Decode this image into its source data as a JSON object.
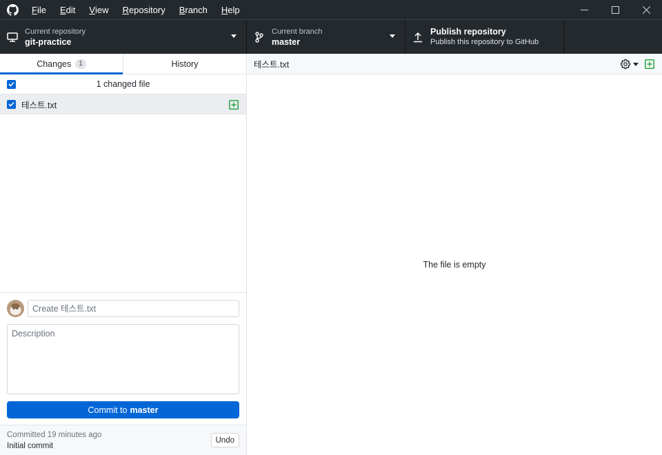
{
  "menu": {
    "items": [
      {
        "underline": "F",
        "rest": "ile"
      },
      {
        "underline": "E",
        "rest": "dit"
      },
      {
        "underline": "V",
        "rest": "iew"
      },
      {
        "underline": "R",
        "rest": "epository"
      },
      {
        "underline": "B",
        "rest": "ranch"
      },
      {
        "underline": "H",
        "rest": "elp"
      }
    ]
  },
  "window_controls": {
    "minimize": "—",
    "maximize": "☐",
    "close": "✕"
  },
  "toolbar": {
    "repo": {
      "label": "Current repository",
      "value": "git-practice"
    },
    "branch": {
      "label": "Current branch",
      "value": "master"
    },
    "publish": {
      "title": "Publish repository",
      "subtitle": "Publish this repository to GitHub"
    }
  },
  "sidebar": {
    "tabs": {
      "changes": "Changes",
      "changes_count": "1",
      "history": "History"
    },
    "changes_header": "1 changed file",
    "files": [
      {
        "name": "테스트.txt",
        "status": "added"
      }
    ]
  },
  "commit": {
    "summary_placeholder": "Create 테스트.txt",
    "description_placeholder": "Description",
    "button_prefix": "Commit to",
    "button_branch": "master"
  },
  "last_commit": {
    "time": "Committed 19 minutes ago",
    "message": "Initial commit",
    "undo": "Undo"
  },
  "diff": {
    "path": "테스트.txt",
    "empty_message": "The file is empty"
  },
  "colors": {
    "accent": "#0366d6",
    "added": "#28a745",
    "chrome": "#24292e"
  },
  "icons": [
    "github-logo-icon",
    "desktop-icon",
    "branch-icon",
    "upload-icon",
    "gear-icon",
    "file-added-icon",
    "checkbox-icon"
  ]
}
